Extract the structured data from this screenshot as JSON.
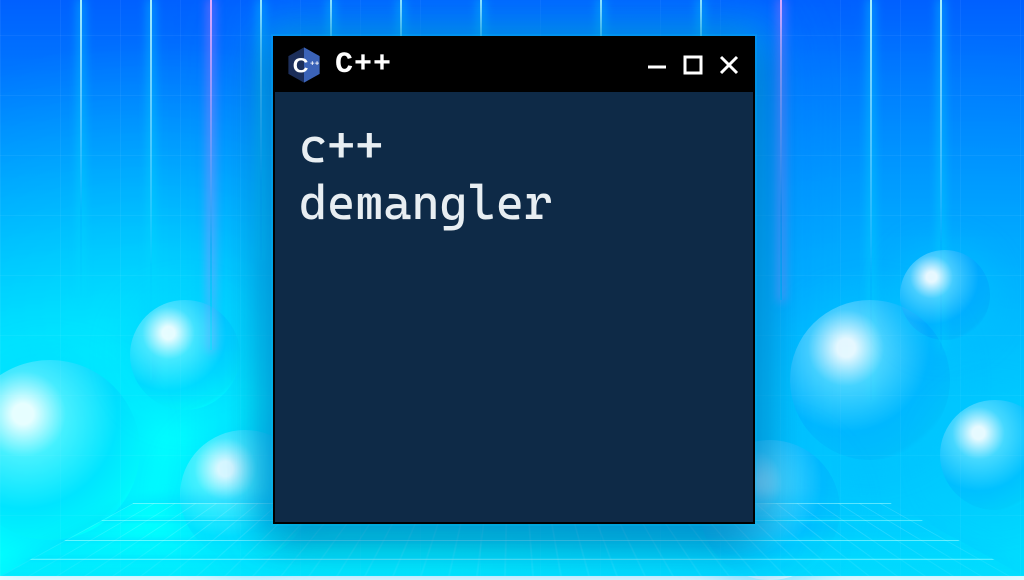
{
  "window": {
    "title": "C++",
    "logo_letter": "C",
    "logo_plus": "++",
    "content_line1": "c++",
    "content_line2": "demangler"
  },
  "controls": {
    "minimize_symbol": "—",
    "maximize_symbol": "□",
    "close_symbol": "×"
  },
  "colors": {
    "window_bg": "#0e2a47",
    "titlebar_bg": "#000000",
    "text": "#e8eef2",
    "logo_dark": "#1c2e5a",
    "logo_light": "#3b63b8"
  }
}
